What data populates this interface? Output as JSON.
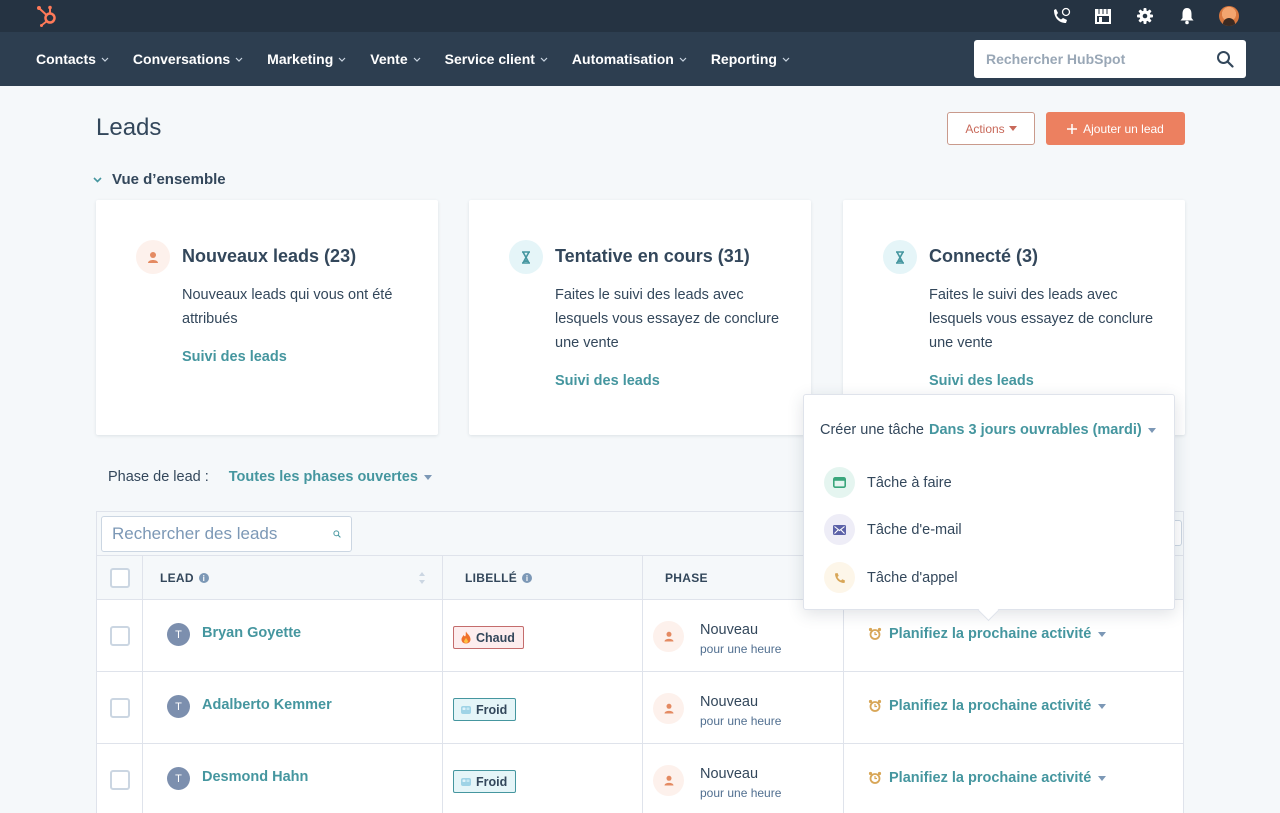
{
  "topbar": {
    "icons": [
      "hubspot-logo",
      "calling-icon",
      "marketplace-icon",
      "settings-icon",
      "notifications-icon",
      "user-avatar"
    ]
  },
  "nav": {
    "items": [
      {
        "label": "Contacts"
      },
      {
        "label": "Conversations"
      },
      {
        "label": "Marketing"
      },
      {
        "label": "Vente"
      },
      {
        "label": "Service client"
      },
      {
        "label": "Automatisation"
      },
      {
        "label": "Reporting"
      }
    ],
    "search_placeholder": "Rechercher HubSpot"
  },
  "page": {
    "title": "Leads",
    "actions_label": "Actions",
    "add_label": "Ajouter un lead",
    "overview_label": "Vue d’ensemble"
  },
  "cards": [
    {
      "title": "Nouveaux leads (23)",
      "description": "Nouveaux leads qui vous ont été attribués",
      "link": "Suivi des leads",
      "icon": "person-icon"
    },
    {
      "title": "Tentative en cours (31)",
      "description": "Faites le suivi des leads avec lesquels vous essayez de conclure une vente",
      "link": "Suivi des leads",
      "icon": "hourglass-icon"
    },
    {
      "title": "Connecté (3)",
      "description": "Faites le suivi des leads avec lesquels vous essayez de conclure une vente",
      "link": "Suivi des leads",
      "icon": "hourglass-icon"
    }
  ],
  "filter": {
    "label": "Phase de lead :",
    "value": "Toutes les phases ouvertes"
  },
  "table": {
    "search_placeholder": "Rechercher des leads",
    "columns": [
      "LEAD",
      "LIBELLÉ",
      "PHASE"
    ],
    "rows": [
      {
        "avatar": "T",
        "name": "Bryan Goyette",
        "tag": "Chaud",
        "tag_type": "hot",
        "phase": "Nouveau",
        "phase_sub": "pour une heure",
        "activity": "Planifiez la prochaine activité"
      },
      {
        "avatar": "T",
        "name": "Adalberto Kemmer",
        "tag": "Froid",
        "tag_type": "cold",
        "phase": "Nouveau",
        "phase_sub": "pour une heure",
        "activity": "Planifiez la prochaine activité"
      },
      {
        "avatar": "T",
        "name": "Desmond Hahn",
        "tag": "Froid",
        "tag_type": "cold",
        "phase": "Nouveau",
        "phase_sub": "pour une heure",
        "activity": "Planifiez la prochaine activité"
      }
    ]
  },
  "popover": {
    "prefix": "Créer une tâche",
    "date": "Dans 3 jours ouvrables (mardi)",
    "items": [
      {
        "label": "Tâche à faire",
        "icon": "todo-icon"
      },
      {
        "label": "Tâche d'e-mail",
        "icon": "email-icon"
      },
      {
        "label": "Tâche d'appel",
        "icon": "phone-icon"
      }
    ]
  },
  "colors": {
    "nav_bg": "#2d3e50",
    "topbar_bg": "#253342",
    "accent_teal": "#45969f",
    "primary_orange": "#ec8060"
  }
}
